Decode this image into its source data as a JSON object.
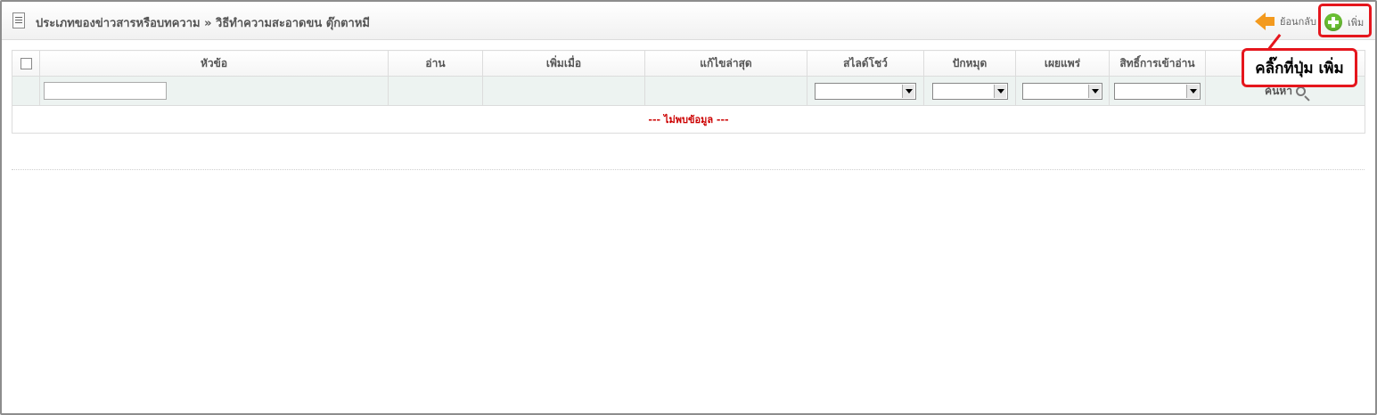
{
  "header": {
    "title": "ประเภทของข่าวสารหรือบทความ » วิธีทำความสะอาดขน ตุ๊กตาหมี",
    "back_label": "ย้อนกลับ",
    "add_label": "เพิ่ม"
  },
  "callout": {
    "text": "คลิ๊กที่ปุ่ม เพิ่ม"
  },
  "table": {
    "columns": [
      "หัวข้อ",
      "อ่าน",
      "เพิ่มเมื่อ",
      "แก้ไขล่าสุด",
      "สไลด์โชว์",
      "ปักหมุด",
      "เผยแพร่",
      "สิทธิ์การเข้าอ่าน"
    ],
    "search_label": "ค้นหา",
    "empty_message": "--- ไม่พบข้อมูล ---"
  },
  "colors": {
    "highlight": "#e5161d",
    "add_icon": "#6abf33",
    "back_icon": "#f39a1e",
    "empty_text": "#cc0000",
    "filter_row_bg": "#edf3f1"
  },
  "icons": [
    "document-icon",
    "back-arrow-icon",
    "add-plus-icon",
    "search-icon",
    "dropdown-arrow-icon"
  ]
}
